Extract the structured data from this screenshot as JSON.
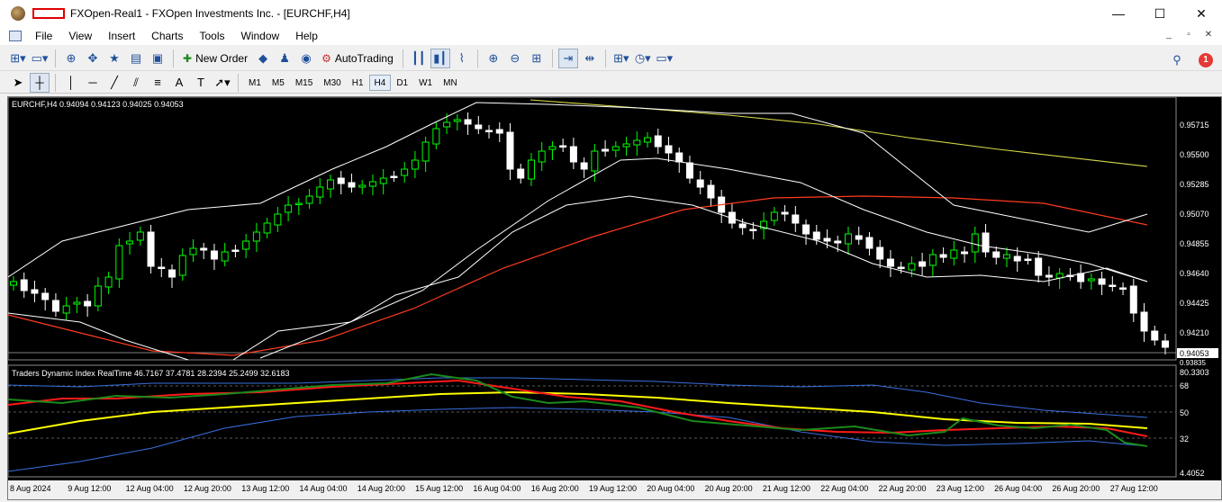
{
  "window": {
    "title": "FXOpen-Real1 - FXOpen Investments Inc. - [EURCHF,H4]",
    "controls": {
      "minimize": "—",
      "maximize": "☐",
      "close": "✕"
    }
  },
  "menu": [
    "File",
    "View",
    "Insert",
    "Charts",
    "Tools",
    "Window",
    "Help"
  ],
  "toolbar": {
    "new_order": "New Order",
    "auto_trading": "AutoTrading",
    "notifications_count": "1"
  },
  "timeframes": [
    "M1",
    "M5",
    "M15",
    "M30",
    "H1",
    "H4",
    "D1",
    "W1",
    "MN"
  ],
  "active_timeframe": "H4",
  "chart": {
    "info": "EURCHF,H4  0.94094 0.94123 0.94025 0.94053",
    "current_price": "0.94053",
    "lower_price_tag": "0.93835",
    "price_ticks": [
      "0.95715",
      "0.95500",
      "0.95285",
      "0.95070",
      "0.94855",
      "0.94640",
      "0.94425",
      "0.94210"
    ],
    "indicator_label": "Traders Dynamic Index RealTime 46.7167 37.4781 28.2394 25.2499 32.6183",
    "indicator_ticks": [
      "80.3303",
      "68",
      "50",
      "32",
      "4.4052"
    ],
    "time_labels": [
      "8 Aug 2024",
      "9 Aug 12:00",
      "12 Aug 04:00",
      "12 Aug 20:00",
      "13 Aug 12:00",
      "14 Aug 04:00",
      "14 Aug 20:00",
      "15 Aug 12:00",
      "16 Aug 04:00",
      "16 Aug 20:00",
      "19 Aug 12:00",
      "20 Aug 04:00",
      "20 Aug 20:00",
      "21 Aug 12:00",
      "22 Aug 04:00",
      "22 Aug 20:00",
      "23 Aug 12:00",
      "26 Aug 04:00",
      "26 Aug 20:00",
      "27 Aug 12:00"
    ],
    "colors": {
      "bull": "#00ff00",
      "bear": "#ffffff",
      "ma_red": "#ff3b1f",
      "ma_yellow": "#d8d84a",
      "bands": "#ffffff",
      "tdi_green": "#1a8a1a",
      "tdi_red": "#ff1a1a",
      "tdi_yellow": "#ffff00",
      "tdi_blue": "#3a6fe0"
    }
  }
}
